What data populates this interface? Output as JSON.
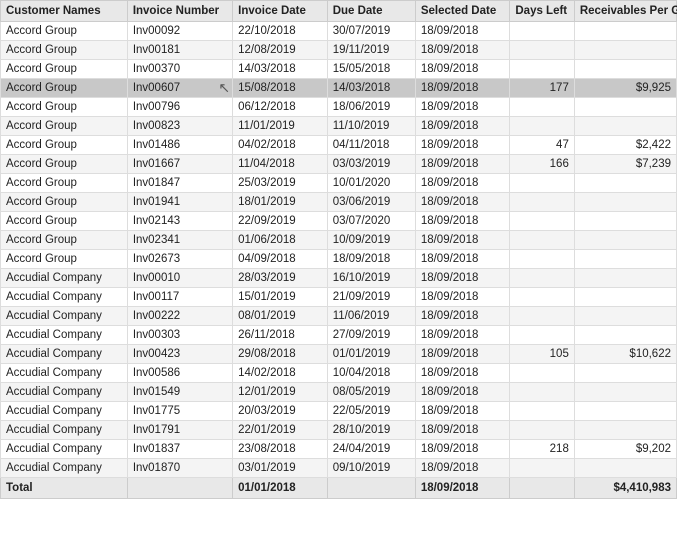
{
  "table": {
    "columns": [
      {
        "label": "Customer Names",
        "key": "customer"
      },
      {
        "label": "Invoice Number",
        "key": "invoice_number"
      },
      {
        "label": "Invoice Date",
        "key": "invoice_date"
      },
      {
        "label": "Due Date",
        "key": "due_date"
      },
      {
        "label": "Selected Date",
        "key": "selected_date"
      },
      {
        "label": "Days Left",
        "key": "days_left"
      },
      {
        "label": "Receivables Per Group",
        "key": "receivables"
      }
    ],
    "rows": [
      {
        "customer": "Accord Group",
        "invoice_number": "Inv00092",
        "invoice_date": "22/10/2018",
        "due_date": "30/07/2019",
        "selected_date": "18/09/2018",
        "days_left": "",
        "receivables": "",
        "highlight": false
      },
      {
        "customer": "Accord Group",
        "invoice_number": "Inv00181",
        "invoice_date": "12/08/2019",
        "due_date": "19/11/2019",
        "selected_date": "18/09/2018",
        "days_left": "",
        "receivables": "",
        "highlight": false
      },
      {
        "customer": "Accord Group",
        "invoice_number": "Inv00370",
        "invoice_date": "14/03/2018",
        "due_date": "15/05/2018",
        "selected_date": "18/09/2018",
        "days_left": "",
        "receivables": "",
        "highlight": false
      },
      {
        "customer": "Accord Group",
        "invoice_number": "Inv00607",
        "invoice_date": "15/08/2018",
        "due_date": "14/03/2018",
        "selected_date": "18/09/2018",
        "days_left": "177",
        "receivables": "$9,925",
        "highlight": true
      },
      {
        "customer": "Accord Group",
        "invoice_number": "Inv00796",
        "invoice_date": "06/12/2018",
        "due_date": "18/06/2019",
        "selected_date": "18/09/2018",
        "days_left": "",
        "receivables": "",
        "highlight": false
      },
      {
        "customer": "Accord Group",
        "invoice_number": "Inv00823",
        "invoice_date": "11/01/2019",
        "due_date": "11/10/2019",
        "selected_date": "18/09/2018",
        "days_left": "",
        "receivables": "",
        "highlight": false
      },
      {
        "customer": "Accord Group",
        "invoice_number": "Inv01486",
        "invoice_date": "04/02/2018",
        "due_date": "04/11/2018",
        "selected_date": "18/09/2018",
        "days_left": "47",
        "receivables": "$2,422",
        "highlight": false
      },
      {
        "customer": "Accord Group",
        "invoice_number": "Inv01667",
        "invoice_date": "11/04/2018",
        "due_date": "03/03/2019",
        "selected_date": "18/09/2018",
        "days_left": "166",
        "receivables": "$7,239",
        "highlight": false
      },
      {
        "customer": "Accord Group",
        "invoice_number": "Inv01847",
        "invoice_date": "25/03/2019",
        "due_date": "10/01/2020",
        "selected_date": "18/09/2018",
        "days_left": "",
        "receivables": "",
        "highlight": false
      },
      {
        "customer": "Accord Group",
        "invoice_number": "Inv01941",
        "invoice_date": "18/01/2019",
        "due_date": "03/06/2019",
        "selected_date": "18/09/2018",
        "days_left": "",
        "receivables": "",
        "highlight": false
      },
      {
        "customer": "Accord Group",
        "invoice_number": "Inv02143",
        "invoice_date": "22/09/2019",
        "due_date": "03/07/2020",
        "selected_date": "18/09/2018",
        "days_left": "",
        "receivables": "",
        "highlight": false
      },
      {
        "customer": "Accord Group",
        "invoice_number": "Inv02341",
        "invoice_date": "01/06/2018",
        "due_date": "10/09/2019",
        "selected_date": "18/09/2018",
        "days_left": "",
        "receivables": "",
        "highlight": false
      },
      {
        "customer": "Accord Group",
        "invoice_number": "Inv02673",
        "invoice_date": "04/09/2018",
        "due_date": "18/09/2018",
        "selected_date": "18/09/2018",
        "days_left": "",
        "receivables": "",
        "highlight": false
      },
      {
        "customer": "Accudial Company",
        "invoice_number": "Inv00010",
        "invoice_date": "28/03/2019",
        "due_date": "16/10/2019",
        "selected_date": "18/09/2018",
        "days_left": "",
        "receivables": "",
        "highlight": false
      },
      {
        "customer": "Accudial Company",
        "invoice_number": "Inv00117",
        "invoice_date": "15/01/2019",
        "due_date": "21/09/2019",
        "selected_date": "18/09/2018",
        "days_left": "",
        "receivables": "",
        "highlight": false
      },
      {
        "customer": "Accudial Company",
        "invoice_number": "Inv00222",
        "invoice_date": "08/01/2019",
        "due_date": "11/06/2019",
        "selected_date": "18/09/2018",
        "days_left": "",
        "receivables": "",
        "highlight": false
      },
      {
        "customer": "Accudial Company",
        "invoice_number": "Inv00303",
        "invoice_date": "26/11/2018",
        "due_date": "27/09/2019",
        "selected_date": "18/09/2018",
        "days_left": "",
        "receivables": "",
        "highlight": false
      },
      {
        "customer": "Accudial Company",
        "invoice_number": "Inv00423",
        "invoice_date": "29/08/2018",
        "due_date": "01/01/2019",
        "selected_date": "18/09/2018",
        "days_left": "105",
        "receivables": "$10,622",
        "highlight": false
      },
      {
        "customer": "Accudial Company",
        "invoice_number": "Inv00586",
        "invoice_date": "14/02/2018",
        "due_date": "10/04/2018",
        "selected_date": "18/09/2018",
        "days_left": "",
        "receivables": "",
        "highlight": false
      },
      {
        "customer": "Accudial Company",
        "invoice_number": "Inv01549",
        "invoice_date": "12/01/2019",
        "due_date": "08/05/2019",
        "selected_date": "18/09/2018",
        "days_left": "",
        "receivables": "",
        "highlight": false
      },
      {
        "customer": "Accudial Company",
        "invoice_number": "Inv01775",
        "invoice_date": "20/03/2019",
        "due_date": "22/05/2019",
        "selected_date": "18/09/2018",
        "days_left": "",
        "receivables": "",
        "highlight": false
      },
      {
        "customer": "Accudial Company",
        "invoice_number": "Inv01791",
        "invoice_date": "22/01/2019",
        "due_date": "28/10/2019",
        "selected_date": "18/09/2018",
        "days_left": "",
        "receivables": "",
        "highlight": false
      },
      {
        "customer": "Accudial Company",
        "invoice_number": "Inv01837",
        "invoice_date": "23/08/2018",
        "due_date": "24/04/2019",
        "selected_date": "18/09/2018",
        "days_left": "218",
        "receivables": "$9,202",
        "highlight": false
      },
      {
        "customer": "Accudial Company",
        "invoice_number": "Inv01870",
        "invoice_date": "03/01/2019",
        "due_date": "09/10/2019",
        "selected_date": "18/09/2018",
        "days_left": "",
        "receivables": "",
        "highlight": false
      }
    ],
    "footer": {
      "label": "Total",
      "invoice_date": "01/01/2018",
      "selected_date": "18/09/2018",
      "receivables": "$4,410,983"
    }
  }
}
